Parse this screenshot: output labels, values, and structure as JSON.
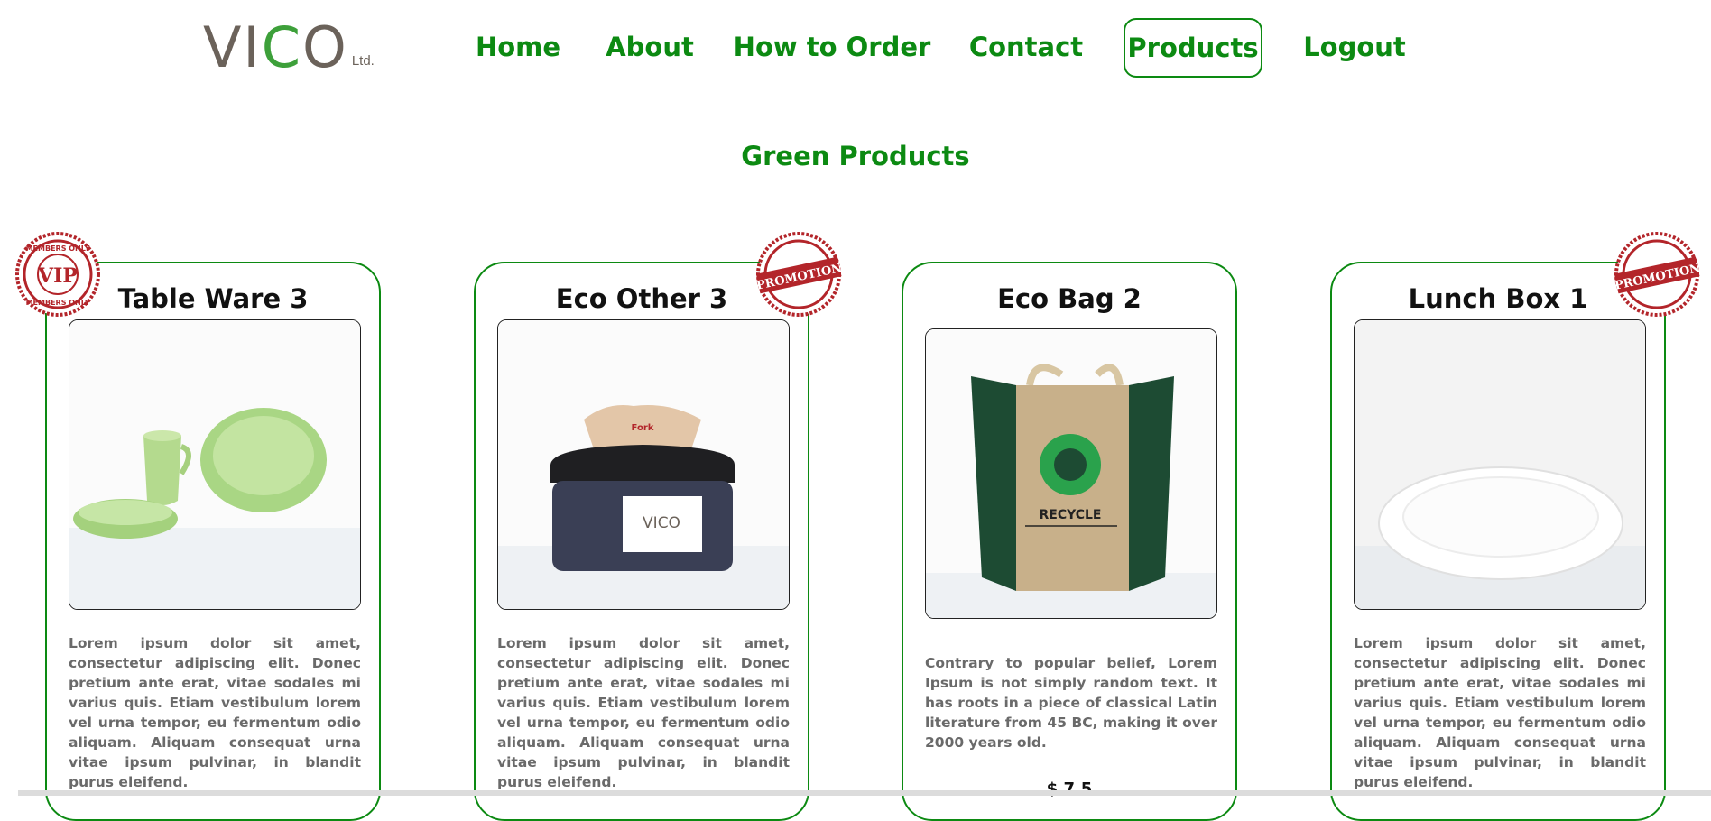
{
  "logo": {
    "text_before": "VI",
    "text_c": "C",
    "text_after": "O",
    "suffix": "Ltd."
  },
  "nav": {
    "items": [
      {
        "label": "Home"
      },
      {
        "label": "About"
      },
      {
        "label": "How to Order"
      },
      {
        "label": "Contact"
      },
      {
        "label": "Products",
        "active": true
      },
      {
        "label": "Logout"
      }
    ]
  },
  "section": {
    "title": "Green Products"
  },
  "badges": {
    "vip": "VIP",
    "members_only": "MEMBERS ONLY",
    "promotion": "PROMOTION"
  },
  "products": [
    {
      "title": "Table Ware 3",
      "badge": "vip",
      "image_icon": "green-tableware-image",
      "description": "Lorem ipsum dolor sit amet, consectetur adipiscing elit. Donec pretium ante erat, vitae sodales mi varius quis. Etiam vestibulum lorem vel urna tempor, eu fermentum odio aliquam. Aliquam consequat urna vitae ipsum pulvinar, in blandit purus eleifend."
    },
    {
      "title": "Eco Other 3",
      "badge": "promotion",
      "image_icon": "napkin-dispenser-image",
      "image_text": "VICO",
      "description": "Lorem ipsum dolor sit amet, consectetur adipiscing elit. Donec pretium ante erat, vitae sodales mi varius quis. Etiam vestibulum lorem vel urna tempor, eu fermentum odio aliquam. Aliquam consequat urna vitae ipsum pulvinar, in blandit purus eleifend."
    },
    {
      "title": "Eco Bag 2",
      "badge": null,
      "image_icon": "recycle-bag-image",
      "image_text": "RECYCLE",
      "description": "Contrary to popular belief, Lorem Ipsum is not simply random text. It has roots in a piece of classical Latin literature from 45 BC, making it over 2000 years old.",
      "price": "$ 7.5"
    },
    {
      "title": "Lunch Box 1",
      "badge": "promotion",
      "image_icon": "white-plate-image",
      "description": "Lorem ipsum dolor sit amet, consectetur adipiscing elit. Donec pretium ante erat, vitae sodales mi varius quis. Etiam vestibulum lorem vel urna tempor, eu fermentum odio aliquam. Aliquam consequat urna vitae ipsum pulvinar, in blandit purus eleifend."
    }
  ],
  "colors": {
    "brand_green": "#0c8a12",
    "logo_gray": "#6b625a",
    "logo_leaf": "#3da03a",
    "stamp_red": "#b3252a"
  }
}
